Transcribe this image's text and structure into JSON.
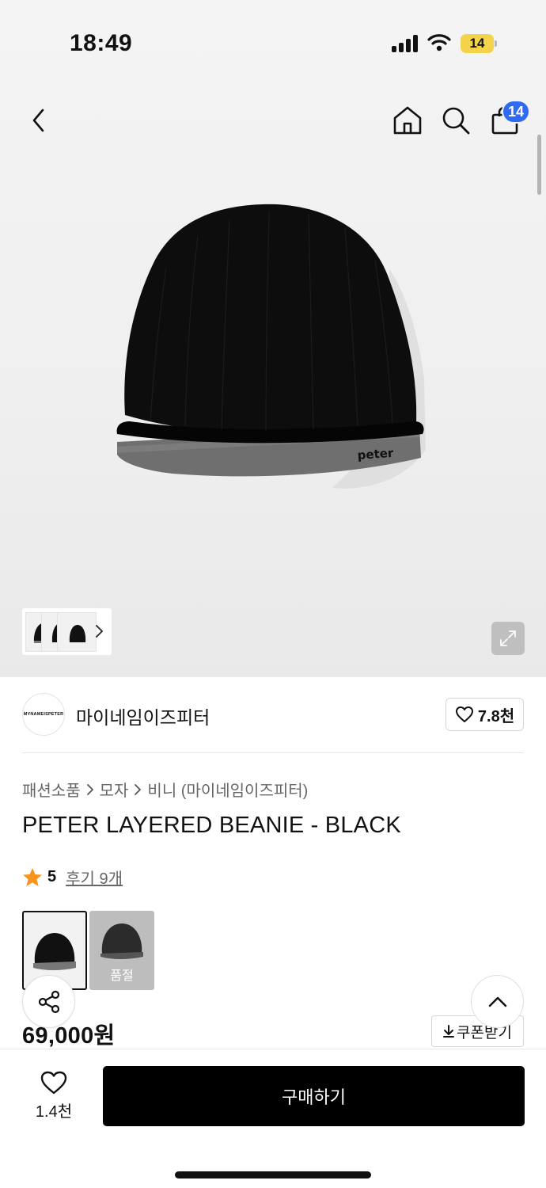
{
  "status_bar": {
    "time": "18:49",
    "battery_level": "14",
    "battery_color": "#f3d34a"
  },
  "nav": {
    "back_icon": "chevron-left-icon",
    "home_icon": "home-icon",
    "search_icon": "search-icon",
    "bag_icon": "shopping-bag-icon",
    "bag_badge": "14",
    "badge_color": "#2f6bf2"
  },
  "gallery": {
    "image_text": "peter",
    "expand_icon": "expand-icon"
  },
  "brand": {
    "logo_text": "MYNAMEISPETER",
    "name": "마이네임이즈피터",
    "like_count": "7.8천"
  },
  "product": {
    "breadcrumb": [
      "패션소품",
      "모자",
      "비니 (마이네임이즈피터)"
    ],
    "title": "PETER LAYERED BEANIE - BLACK",
    "rating": "5",
    "review_link": "후기 9개",
    "star_color": "#f7941d",
    "options": [
      {
        "state": "selected"
      },
      {
        "state": "soldout",
        "label": "품절"
      }
    ],
    "price": "69,000원",
    "coupon_label": "쿠폰받기"
  },
  "bottom_bar": {
    "like_count": "1.4천",
    "buy_label": "구매하기"
  }
}
